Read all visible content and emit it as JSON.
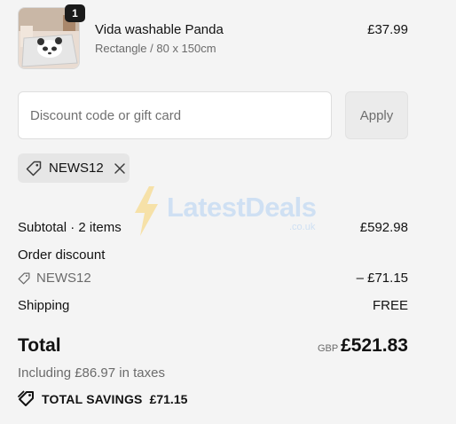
{
  "line_item": {
    "quantity": "1",
    "name": "Vida washable Panda",
    "variant": "Rectangle / 80 x 150cm",
    "price": "£37.99"
  },
  "discount": {
    "placeholder": "Discount code or gift card",
    "value": "",
    "apply_label": "Apply",
    "applied_code": "NEWS12"
  },
  "watermark": {
    "text": "LatestDeals",
    "sub": ".co.uk"
  },
  "summary": {
    "subtotal_label": "Subtotal · 2 items",
    "subtotal_value": "£592.98",
    "order_discount_label": "Order discount",
    "discount_code": "NEWS12",
    "discount_value": "– £71.15",
    "shipping_label": "Shipping",
    "shipping_value": "FREE",
    "total_label": "Total",
    "currency": "GBP",
    "total_value": "£521.83",
    "taxes_text": "Including £86.97 in taxes",
    "savings_label": "TOTAL SAVINGS",
    "savings_value": "£71.15"
  },
  "icons": {
    "tag": "tag-icon",
    "close": "close-icon",
    "savings": "savings-tag-icon"
  },
  "colors": {
    "background": "#f4f4f4",
    "text": "#121212",
    "muted": "#6b6b6b",
    "badge": "#1a1a1a"
  }
}
